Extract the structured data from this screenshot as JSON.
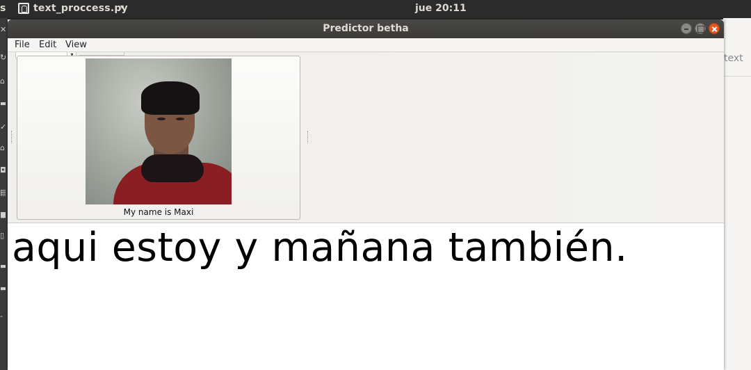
{
  "topbar": {
    "activities_label": "s",
    "app_name": "text_proccess.py",
    "app_menu_caret": "▾",
    "clock": "jue 20:11"
  },
  "background_window": {
    "partial_text": "text"
  },
  "window": {
    "title": "Predictor betha",
    "menu": {
      "file": "File",
      "edit": "Edit",
      "view": "View"
    }
  },
  "photo_panel": {
    "caption": "My name is Maxi"
  },
  "text_area": {
    "content": "aqui estoy y mañana también."
  },
  "colors": {
    "titlebar": "#3c3b37",
    "close_button": "#e9541f",
    "shirt": "#8a1e22"
  }
}
